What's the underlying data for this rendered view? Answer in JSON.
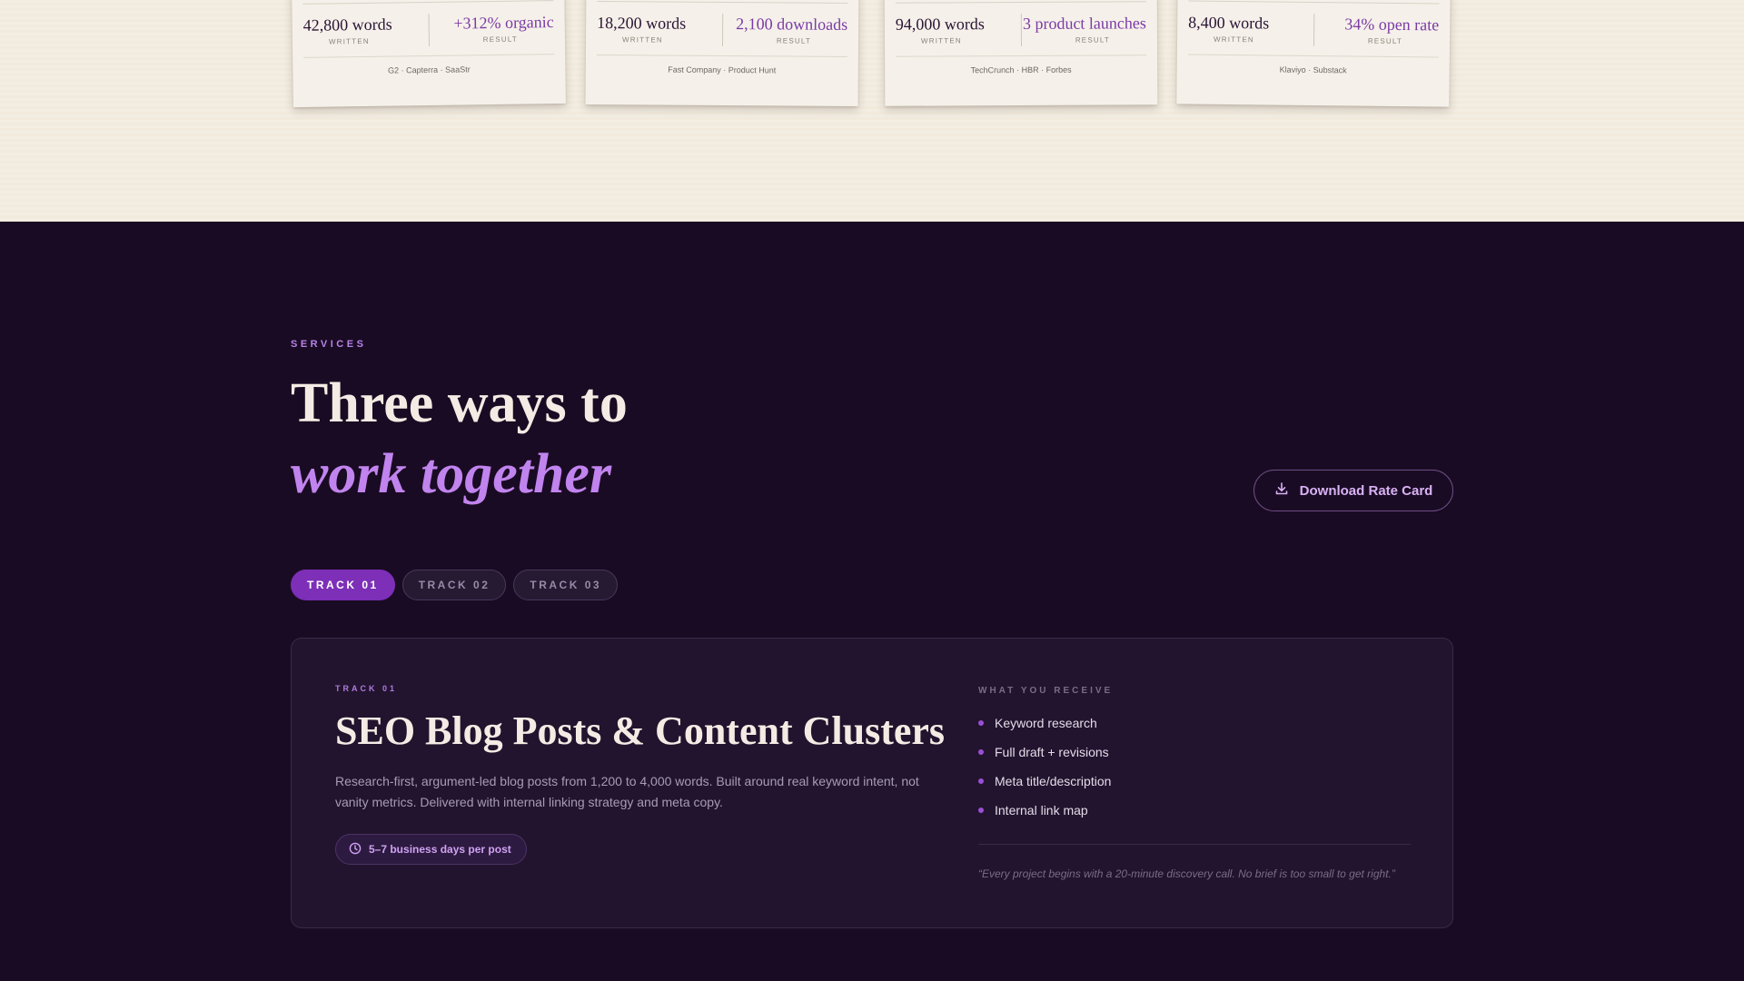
{
  "cards": [
    {
      "words": "42,800 words",
      "written_label": "WRITTEN",
      "result": "+312% organic",
      "result_label": "RESULT",
      "sources": "G2 · Capterra · SaaStr"
    },
    {
      "words": "18,200 words",
      "written_label": "WRITTEN",
      "result": "2,100 downloads",
      "result_label": "RESULT",
      "sources": "Fast Company · Product Hunt"
    },
    {
      "words": "94,000 words",
      "written_label": "WRITTEN",
      "result": "3 product launches",
      "result_label": "RESULT",
      "sources": "TechCrunch · HBR · Forbes"
    },
    {
      "words": "8,400 words",
      "written_label": "WRITTEN",
      "result": "34% open rate",
      "result_label": "RESULT",
      "sources": "Klaviyo · Substack"
    }
  ],
  "services": {
    "eyebrow": "SERVICES",
    "headline_line1": "Three ways to",
    "headline_line2": "work together",
    "download_button": "Download Rate Card",
    "download_icon": "download-icon"
  },
  "tabs": [
    {
      "label": "TRACK 01",
      "active": true
    },
    {
      "label": "TRACK 02",
      "active": false
    },
    {
      "label": "TRACK 03",
      "active": false
    }
  ],
  "panel": {
    "eyebrow": "TRACK 01",
    "title": "SEO Blog Posts & Content Clusters",
    "description": "Research-first, argument-led blog posts from 1,200 to 4,000 words. Built around real keyword intent, not vanity metrics. Delivered with internal linking strategy and meta copy.",
    "turnaround": "5–7 business days per post",
    "turnaround_icon": "clock-icon",
    "receive_title": "WHAT YOU RECEIVE",
    "receive_items": [
      "Keyword research",
      "Full draft + revisions",
      "Meta title/description",
      "Internal link map"
    ],
    "quote": "“Every project begins with a 20-minute discovery call. No brief is too small to get right.”"
  },
  "colors": {
    "background_dark": "#1a0b24",
    "background_cream": "#f3ede2",
    "accent_purple": "#7d2fb8",
    "accent_lavender": "#c184ee"
  }
}
